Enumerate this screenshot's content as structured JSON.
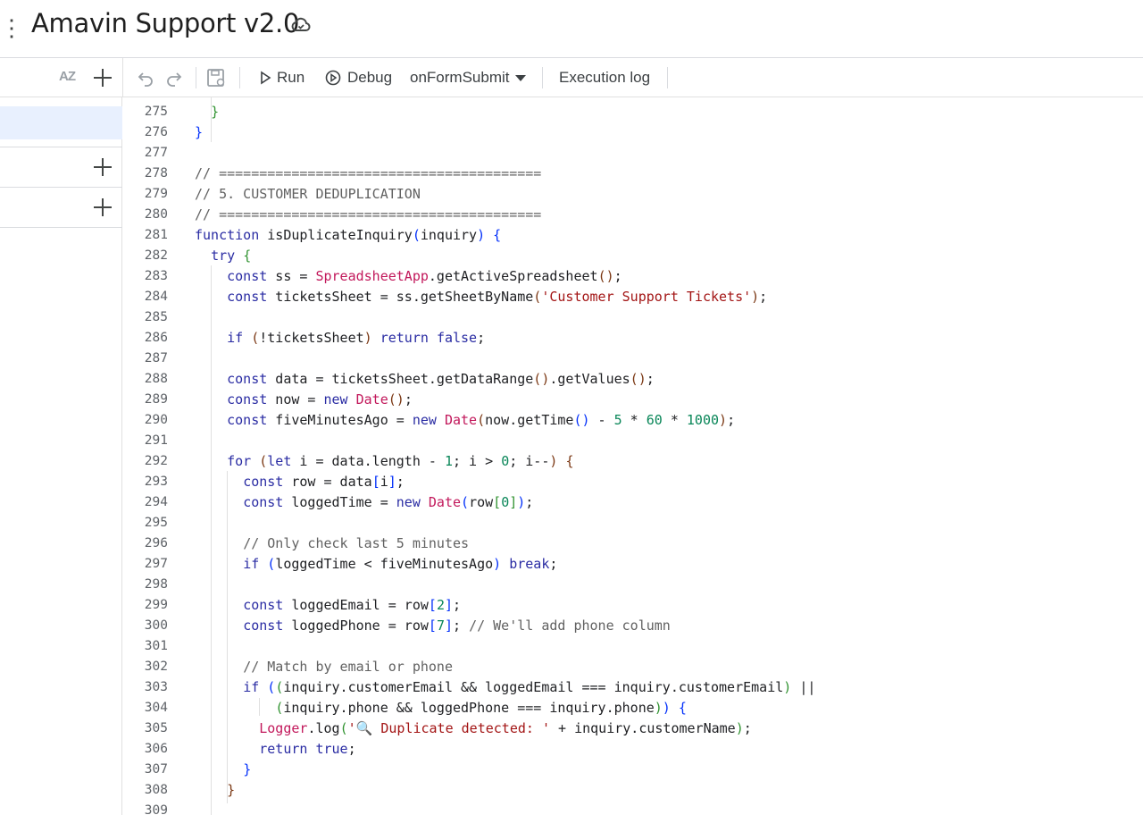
{
  "app": {
    "title": "Amavin Support v2.0",
    "menu_glyph": "⋮"
  },
  "sidebar": {
    "sort_label": "AZ"
  },
  "toolbar": {
    "run_label": "Run",
    "debug_label": "Debug",
    "function_select": "onFormSubmit",
    "execution_log_label": "Execution log"
  },
  "colors": {
    "keyword": "#2a2ca3",
    "comment": "#616161",
    "string": "#a31515",
    "number": "#098658",
    "class": "#c2185b",
    "active_file": "#e8f0fe"
  },
  "editor": {
    "lines": [
      {
        "n": "275",
        "tokens": [
          [
            "  ",
            ""
          ],
          [
            "}",
            "br2"
          ]
        ]
      },
      {
        "n": "276",
        "tokens": [
          [
            "}",
            "br1"
          ]
        ]
      },
      {
        "n": "277",
        "tokens": []
      },
      {
        "n": "278",
        "tokens": [
          [
            "// ========================================",
            "cm"
          ]
        ]
      },
      {
        "n": "279",
        "tokens": [
          [
            "// 5. CUSTOMER DEDUPLICATION",
            "cm"
          ]
        ]
      },
      {
        "n": "280",
        "tokens": [
          [
            "// ========================================",
            "cm"
          ]
        ]
      },
      {
        "n": "281",
        "tokens": [
          [
            "function",
            "kw"
          ],
          [
            " isDuplicateInquiry",
            "fn"
          ],
          [
            "(",
            "br1"
          ],
          [
            "inquiry",
            "pr"
          ],
          [
            ")",
            "br1"
          ],
          [
            " ",
            ""
          ],
          [
            "{",
            "br1"
          ]
        ]
      },
      {
        "n": "282",
        "tokens": [
          [
            "  ",
            ""
          ],
          [
            "try",
            "kw"
          ],
          [
            " ",
            ""
          ],
          [
            "{",
            "br2"
          ]
        ]
      },
      {
        "n": "283",
        "tokens": [
          [
            "    ",
            ""
          ],
          [
            "const",
            "kw"
          ],
          [
            " ss = ",
            "op"
          ],
          [
            "SpreadsheetApp",
            "cls"
          ],
          [
            ".getActiveSpreadsheet",
            "fn"
          ],
          [
            "()",
            "br3"
          ],
          [
            ";",
            "op"
          ]
        ]
      },
      {
        "n": "284",
        "tokens": [
          [
            "    ",
            ""
          ],
          [
            "const",
            "kw"
          ],
          [
            " ticketsSheet = ss.getSheetByName",
            "op"
          ],
          [
            "(",
            "br3"
          ],
          [
            "'Customer Support Tickets'",
            "str"
          ],
          [
            ")",
            "br3"
          ],
          [
            ";",
            "op"
          ]
        ]
      },
      {
        "n": "285",
        "tokens": []
      },
      {
        "n": "286",
        "tokens": [
          [
            "    ",
            ""
          ],
          [
            "if",
            "kw"
          ],
          [
            " ",
            ""
          ],
          [
            "(",
            "br3"
          ],
          [
            "!ticketsSheet",
            "op"
          ],
          [
            ")",
            "br3"
          ],
          [
            " ",
            ""
          ],
          [
            "return",
            "kw"
          ],
          [
            " ",
            ""
          ],
          [
            "false",
            "kw"
          ],
          [
            ";",
            "op"
          ]
        ]
      },
      {
        "n": "287",
        "tokens": []
      },
      {
        "n": "288",
        "tokens": [
          [
            "    ",
            ""
          ],
          [
            "const",
            "kw"
          ],
          [
            " data = ticketsSheet.getDataRange",
            "op"
          ],
          [
            "()",
            "br3"
          ],
          [
            ".getValues",
            "op"
          ],
          [
            "()",
            "br3"
          ],
          [
            ";",
            "op"
          ]
        ]
      },
      {
        "n": "289",
        "tokens": [
          [
            "    ",
            ""
          ],
          [
            "const",
            "kw"
          ],
          [
            " now = ",
            "op"
          ],
          [
            "new",
            "kw"
          ],
          [
            " ",
            ""
          ],
          [
            "Date",
            "cls"
          ],
          [
            "()",
            "br3"
          ],
          [
            ";",
            "op"
          ]
        ]
      },
      {
        "n": "290",
        "tokens": [
          [
            "    ",
            ""
          ],
          [
            "const",
            "kw"
          ],
          [
            " fiveMinutesAgo = ",
            "op"
          ],
          [
            "new",
            "kw"
          ],
          [
            " ",
            ""
          ],
          [
            "Date",
            "cls"
          ],
          [
            "(",
            "br3"
          ],
          [
            "now.getTime",
            "op"
          ],
          [
            "()",
            "br1"
          ],
          [
            " - ",
            "op"
          ],
          [
            "5",
            "num"
          ],
          [
            " * ",
            "op"
          ],
          [
            "60",
            "num"
          ],
          [
            " * ",
            "op"
          ],
          [
            "1000",
            "num"
          ],
          [
            ")",
            "br3"
          ],
          [
            ";",
            "op"
          ]
        ]
      },
      {
        "n": "291",
        "tokens": []
      },
      {
        "n": "292",
        "tokens": [
          [
            "    ",
            ""
          ],
          [
            "for",
            "kw"
          ],
          [
            " ",
            ""
          ],
          [
            "(",
            "br3"
          ],
          [
            "let",
            "kw"
          ],
          [
            " i = data.length - ",
            "op"
          ],
          [
            "1",
            "num"
          ],
          [
            "; i > ",
            "op"
          ],
          [
            "0",
            "num"
          ],
          [
            "; i--",
            "op"
          ],
          [
            ")",
            "br3"
          ],
          [
            " ",
            ""
          ],
          [
            "{",
            "br3"
          ]
        ]
      },
      {
        "n": "293",
        "tokens": [
          [
            "      ",
            ""
          ],
          [
            "const",
            "kw"
          ],
          [
            " row = data",
            "op"
          ],
          [
            "[",
            "br1"
          ],
          [
            "i",
            "op"
          ],
          [
            "]",
            "br1"
          ],
          [
            ";",
            "op"
          ]
        ]
      },
      {
        "n": "294",
        "tokens": [
          [
            "      ",
            ""
          ],
          [
            "const",
            "kw"
          ],
          [
            " loggedTime = ",
            "op"
          ],
          [
            "new",
            "kw"
          ],
          [
            " ",
            ""
          ],
          [
            "Date",
            "cls"
          ],
          [
            "(",
            "br1"
          ],
          [
            "row",
            "op"
          ],
          [
            "[",
            "br2"
          ],
          [
            "0",
            "num"
          ],
          [
            "]",
            "br2"
          ],
          [
            ")",
            "br1"
          ],
          [
            ";",
            "op"
          ]
        ]
      },
      {
        "n": "295",
        "tokens": []
      },
      {
        "n": "296",
        "tokens": [
          [
            "      ",
            ""
          ],
          [
            "// Only check last 5 minutes",
            "cm"
          ]
        ]
      },
      {
        "n": "297",
        "tokens": [
          [
            "      ",
            ""
          ],
          [
            "if",
            "kw"
          ],
          [
            " ",
            ""
          ],
          [
            "(",
            "br1"
          ],
          [
            "loggedTime < fiveMinutesAgo",
            "op"
          ],
          [
            ")",
            "br1"
          ],
          [
            " ",
            ""
          ],
          [
            "break",
            "kw"
          ],
          [
            ";",
            "op"
          ]
        ]
      },
      {
        "n": "298",
        "tokens": []
      },
      {
        "n": "299",
        "tokens": [
          [
            "      ",
            ""
          ],
          [
            "const",
            "kw"
          ],
          [
            " loggedEmail = row",
            "op"
          ],
          [
            "[",
            "br1"
          ],
          [
            "2",
            "num"
          ],
          [
            "]",
            "br1"
          ],
          [
            ";",
            "op"
          ]
        ]
      },
      {
        "n": "300",
        "tokens": [
          [
            "      ",
            ""
          ],
          [
            "const",
            "kw"
          ],
          [
            " loggedPhone = row",
            "op"
          ],
          [
            "[",
            "br1"
          ],
          [
            "7",
            "num"
          ],
          [
            "]",
            "br1"
          ],
          [
            "; ",
            "op"
          ],
          [
            "// We'll add phone column",
            "cm"
          ]
        ]
      },
      {
        "n": "301",
        "tokens": []
      },
      {
        "n": "302",
        "tokens": [
          [
            "      ",
            ""
          ],
          [
            "// Match by email or phone",
            "cm"
          ]
        ]
      },
      {
        "n": "303",
        "tokens": [
          [
            "      ",
            ""
          ],
          [
            "if",
            "kw"
          ],
          [
            " ",
            ""
          ],
          [
            "(",
            "br1"
          ],
          [
            "(",
            "br2"
          ],
          [
            "inquiry.customerEmail && loggedEmail === inquiry.customerEmail",
            "op"
          ],
          [
            ")",
            "br2"
          ],
          [
            " ||",
            "op"
          ]
        ]
      },
      {
        "n": "304",
        "tokens": [
          [
            "          ",
            ""
          ],
          [
            "(",
            "br2"
          ],
          [
            "inquiry.phone && loggedPhone === inquiry.phone",
            "op"
          ],
          [
            ")",
            "br2"
          ],
          [
            ")",
            "br1"
          ],
          [
            " ",
            ""
          ],
          [
            "{",
            "br1"
          ]
        ]
      },
      {
        "n": "305",
        "tokens": [
          [
            "        ",
            ""
          ],
          [
            "Logger",
            "cls"
          ],
          [
            ".log",
            "op"
          ],
          [
            "(",
            "br2"
          ],
          [
            "'🔍 Duplicate detected: '",
            "str"
          ],
          [
            " + inquiry.customerName",
            "op"
          ],
          [
            ")",
            "br2"
          ],
          [
            ";",
            "op"
          ]
        ]
      },
      {
        "n": "306",
        "tokens": [
          [
            "        ",
            ""
          ],
          [
            "return",
            "kw"
          ],
          [
            " ",
            ""
          ],
          [
            "true",
            "kw"
          ],
          [
            ";",
            "op"
          ]
        ]
      },
      {
        "n": "307",
        "tokens": [
          [
            "      ",
            ""
          ],
          [
            "}",
            "br1"
          ]
        ]
      },
      {
        "n": "308",
        "tokens": [
          [
            "    ",
            ""
          ],
          [
            "}",
            "br3"
          ]
        ]
      },
      {
        "n": "309",
        "tokens": []
      }
    ]
  }
}
